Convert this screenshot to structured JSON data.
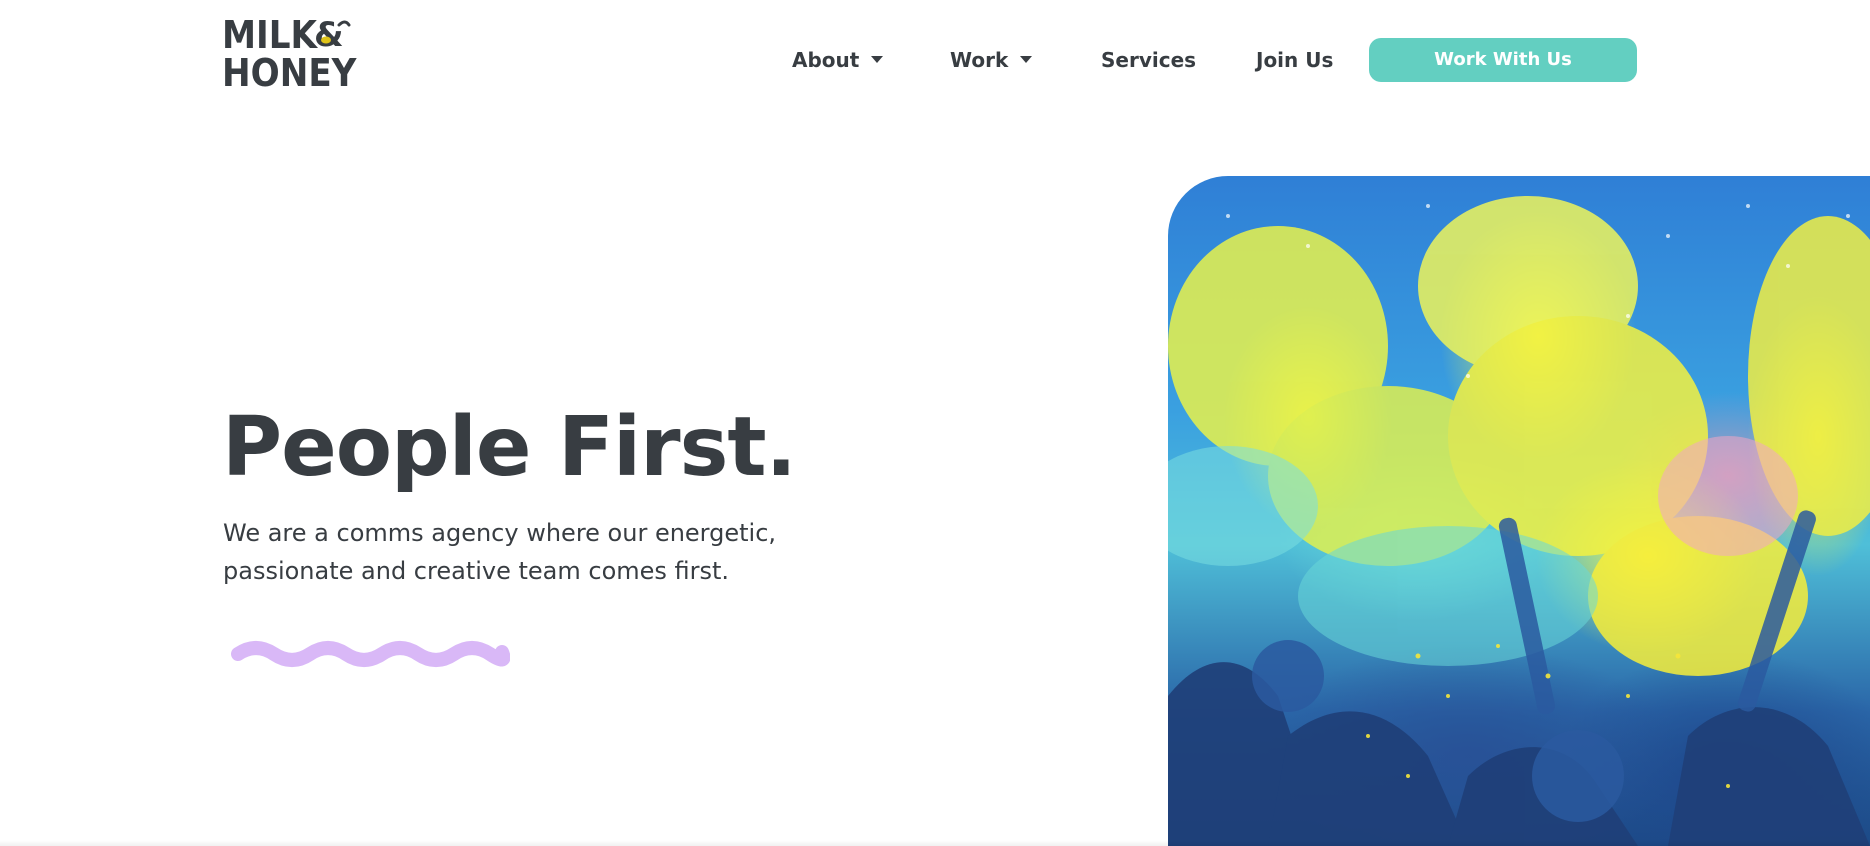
{
  "logo": {
    "line1": "MILK",
    "amp": "&",
    "line2": "HONEY"
  },
  "nav": {
    "items": [
      {
        "label": "About",
        "has_dropdown": true
      },
      {
        "label": "Work",
        "has_dropdown": true
      },
      {
        "label": "Services",
        "has_dropdown": false
      },
      {
        "label": "Join Us",
        "has_dropdown": false
      }
    ],
    "cta_label": "Work With Us"
  },
  "hero": {
    "title": "People First.",
    "subtitle": "We are a comms agency where our energetic, passionate and creative team comes first."
  },
  "colors": {
    "text": "#383d42",
    "accent_teal": "#63cfc1",
    "squiggle_lilac": "#d9b8f7",
    "background": "#ffffff"
  },
  "icons": {
    "caret": "chevron-down-icon",
    "squiggle": "wave-decoration"
  }
}
